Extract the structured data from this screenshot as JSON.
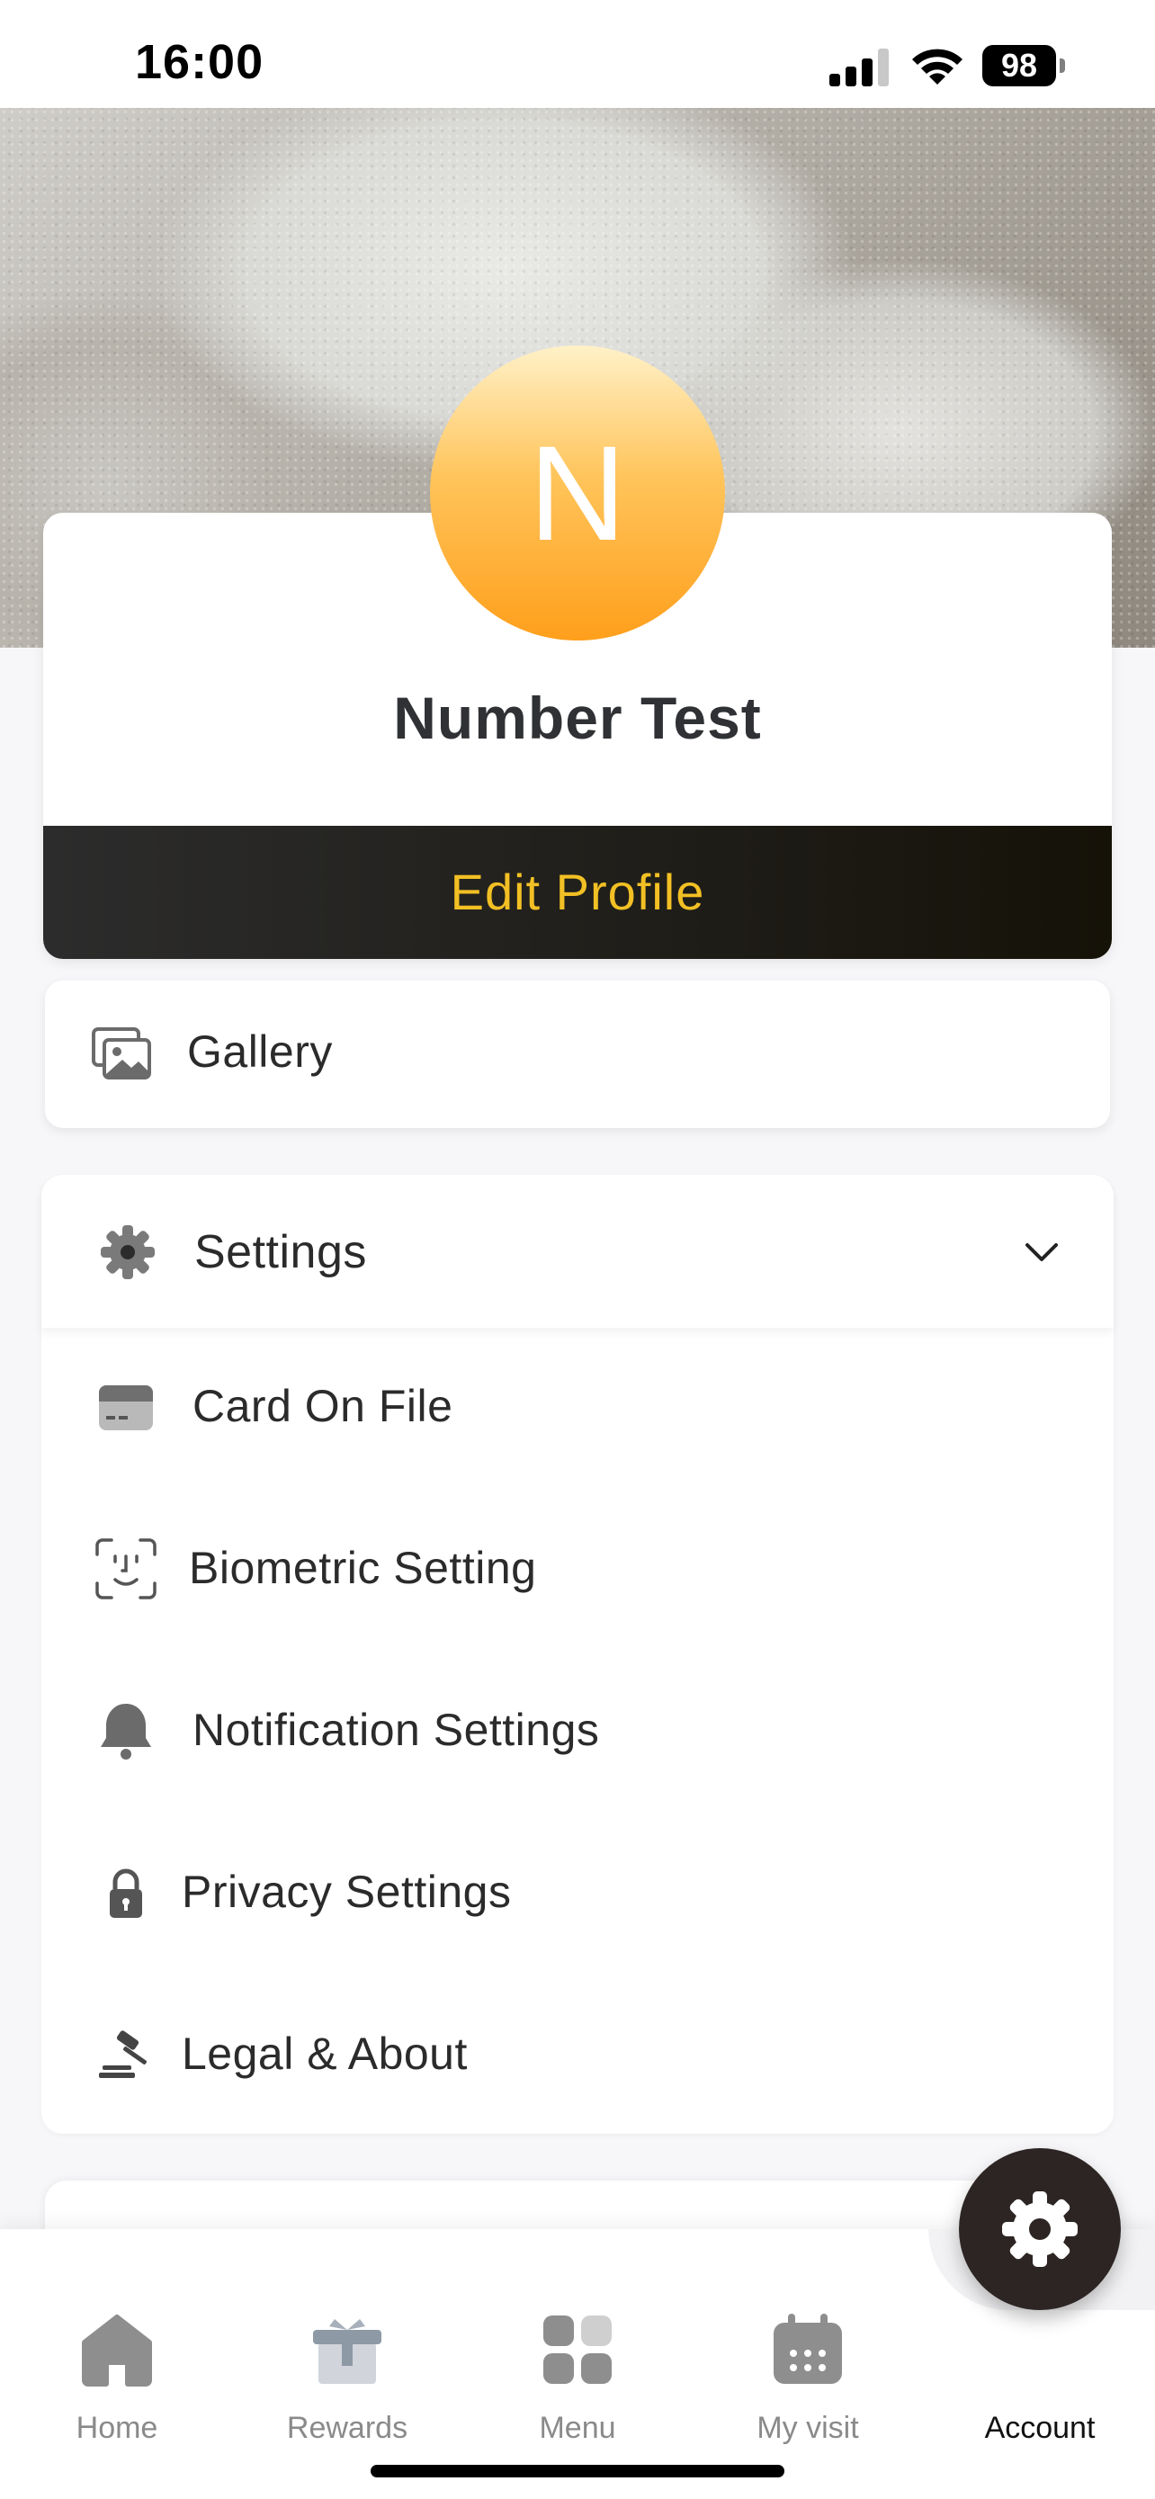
{
  "status_bar": {
    "time": "16:00",
    "battery": "98"
  },
  "profile": {
    "avatar_initial": "N",
    "name": "Number Test",
    "edit_label": "Edit Profile"
  },
  "gallery": {
    "label": "Gallery"
  },
  "settings": {
    "label": "Settings",
    "items": [
      {
        "label": "Card On File",
        "icon": "card-icon"
      },
      {
        "label": "Biometric Setting",
        "icon": "face-id-icon"
      },
      {
        "label": "Notification Settings",
        "icon": "bell-icon"
      },
      {
        "label": "Privacy Settings",
        "icon": "lock-icon"
      },
      {
        "label": "Legal & About",
        "icon": "gavel-icon"
      }
    ]
  },
  "tabs": [
    {
      "label": "Home",
      "icon": "home-icon"
    },
    {
      "label": "Rewards",
      "icon": "gift-icon"
    },
    {
      "label": "Menu",
      "icon": "grid-icon"
    },
    {
      "label": "My visit",
      "icon": "calendar-icon"
    },
    {
      "label": "Account",
      "icon": "gear-icon",
      "active": true
    }
  ],
  "colors": {
    "accent_gold": "#f2c024",
    "avatar_orange": "#ff9f1c",
    "dark_bar": "#1f1d18",
    "icon_gray": "#6b6b6b"
  }
}
